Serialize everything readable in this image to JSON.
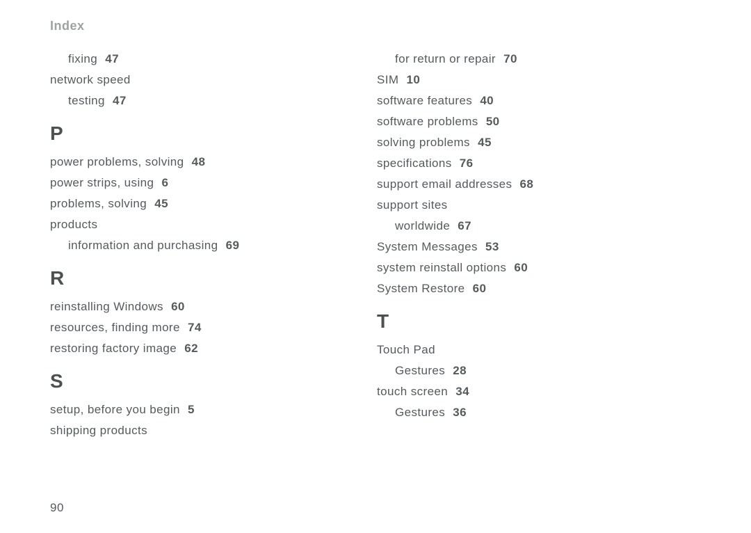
{
  "header": "Index",
  "page_number": "90",
  "left_column": [
    {
      "type": "entry",
      "indent": 1,
      "label": "fixing",
      "page": "47"
    },
    {
      "type": "entry",
      "indent": 0,
      "label": "network speed",
      "page": ""
    },
    {
      "type": "entry",
      "indent": 1,
      "label": "testing",
      "page": "47"
    },
    {
      "type": "letter",
      "text": "P"
    },
    {
      "type": "entry",
      "indent": 0,
      "label": "power problems, solving",
      "page": "48"
    },
    {
      "type": "entry",
      "indent": 0,
      "label": "power strips, using",
      "page": "6"
    },
    {
      "type": "entry",
      "indent": 0,
      "label": "problems, solving",
      "page": "45"
    },
    {
      "type": "entry",
      "indent": 0,
      "label": "products",
      "page": ""
    },
    {
      "type": "entry",
      "indent": 1,
      "label": "information and purchasing",
      "page": "69"
    },
    {
      "type": "letter",
      "text": "R"
    },
    {
      "type": "entry",
      "indent": 0,
      "label": "reinstalling Windows",
      "page": "60"
    },
    {
      "type": "entry",
      "indent": 0,
      "label": "resources, finding more",
      "page": "74"
    },
    {
      "type": "entry",
      "indent": 0,
      "label": "restoring factory image",
      "page": "62"
    },
    {
      "type": "letter",
      "text": "S"
    },
    {
      "type": "entry",
      "indent": 0,
      "label": "setup, before you begin",
      "page": "5"
    },
    {
      "type": "entry",
      "indent": 0,
      "label": "shipping products",
      "page": ""
    }
  ],
  "right_column": [
    {
      "type": "entry",
      "indent": 1,
      "label": "for return or repair",
      "page": "70"
    },
    {
      "type": "entry",
      "indent": 0,
      "label": "SIM",
      "page": "10"
    },
    {
      "type": "entry",
      "indent": 0,
      "label": "software features",
      "page": "40"
    },
    {
      "type": "entry",
      "indent": 0,
      "label": "software problems",
      "page": "50"
    },
    {
      "type": "entry",
      "indent": 0,
      "label": "solving problems",
      "page": "45"
    },
    {
      "type": "entry",
      "indent": 0,
      "label": "specifications",
      "page": "76"
    },
    {
      "type": "entry",
      "indent": 0,
      "label": "support email addresses",
      "page": "68"
    },
    {
      "type": "entry",
      "indent": 0,
      "label": "support sites",
      "page": ""
    },
    {
      "type": "entry",
      "indent": 1,
      "label": "worldwide",
      "page": "67"
    },
    {
      "type": "entry",
      "indent": 0,
      "label": "System Messages",
      "page": "53"
    },
    {
      "type": "entry",
      "indent": 0,
      "label": "system reinstall options",
      "page": "60"
    },
    {
      "type": "entry",
      "indent": 0,
      "label": "System Restore",
      "page": "60"
    },
    {
      "type": "letter",
      "text": "T"
    },
    {
      "type": "entry",
      "indent": 0,
      "label": "Touch Pad",
      "page": ""
    },
    {
      "type": "entry",
      "indent": 1,
      "label": "Gestures",
      "page": "28"
    },
    {
      "type": "entry",
      "indent": 0,
      "label": "touch screen",
      "page": "34"
    },
    {
      "type": "entry",
      "indent": 1,
      "label": "Gestures",
      "page": "36"
    }
  ]
}
